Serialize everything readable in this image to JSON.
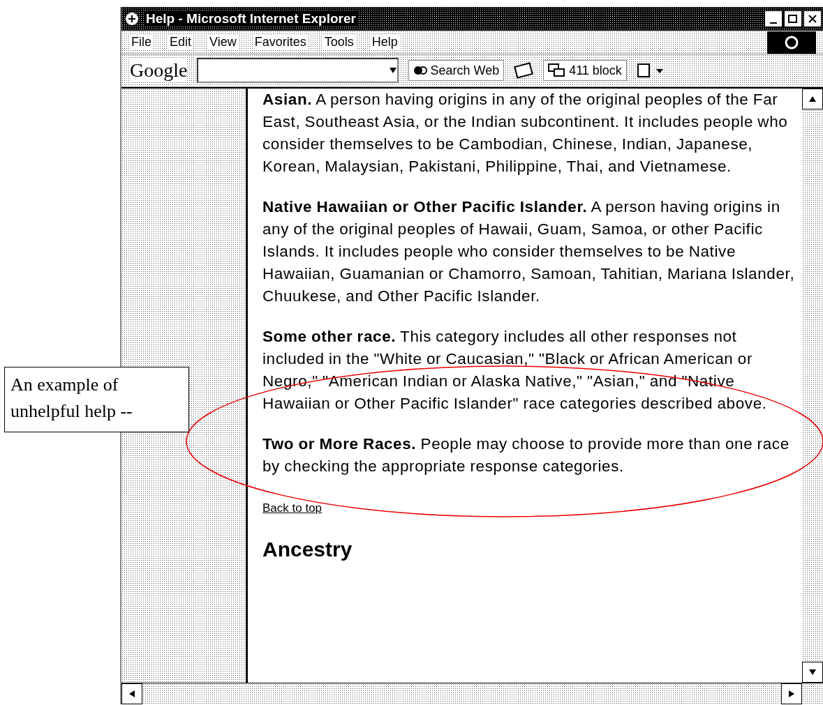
{
  "window": {
    "title": "Help - Microsoft Internet Explorer"
  },
  "menu": [
    "File",
    "Edit",
    "View",
    "Favorites",
    "Tools",
    "Help"
  ],
  "google_toolbar": {
    "logo": "Google",
    "search_button": "Search Web",
    "blocker_button": "411 block"
  },
  "content": {
    "paragraphs": [
      {
        "text": "**Asian.** A person having origins in any of the original peoples of the Far East, Southeast Asia, or the Indian subcontinent. It includes people who consider themselves to be Cambodian, Chinese, Indian, Japanese, Korean, Malaysian, Pakistani, Philippine, Thai, and Vietnamese."
      },
      {
        "text": "**Native Hawaiian or Other Pacific Islander.** A person having origins in any of the original peoples of Hawaii, Guam, Samoa, or other Pacific Islands. It includes people who consider themselves to be Native Hawaiian, Guamanian or Chamorro, Samoan, Tahitian, Mariana Islander, Chuukese, and Other Pacific Islander."
      },
      {
        "text": "**Some other race.** This category includes all other responses not included in the \"White or Caucasian,\" \"Black or African American or Negro,\" \"American Indian or Alaska Native,\" \"Asian,\" and \"Native Hawaiian or Other Pacific Islander\" race categories described above."
      },
      {
        "text": "**Two or More Races.** People may choose to provide more than one race by checking the appropriate response categories."
      }
    ],
    "link": "Back to top",
    "heading": "Ancestry"
  },
  "callout": {
    "text": "An example of unhelpful help --"
  }
}
